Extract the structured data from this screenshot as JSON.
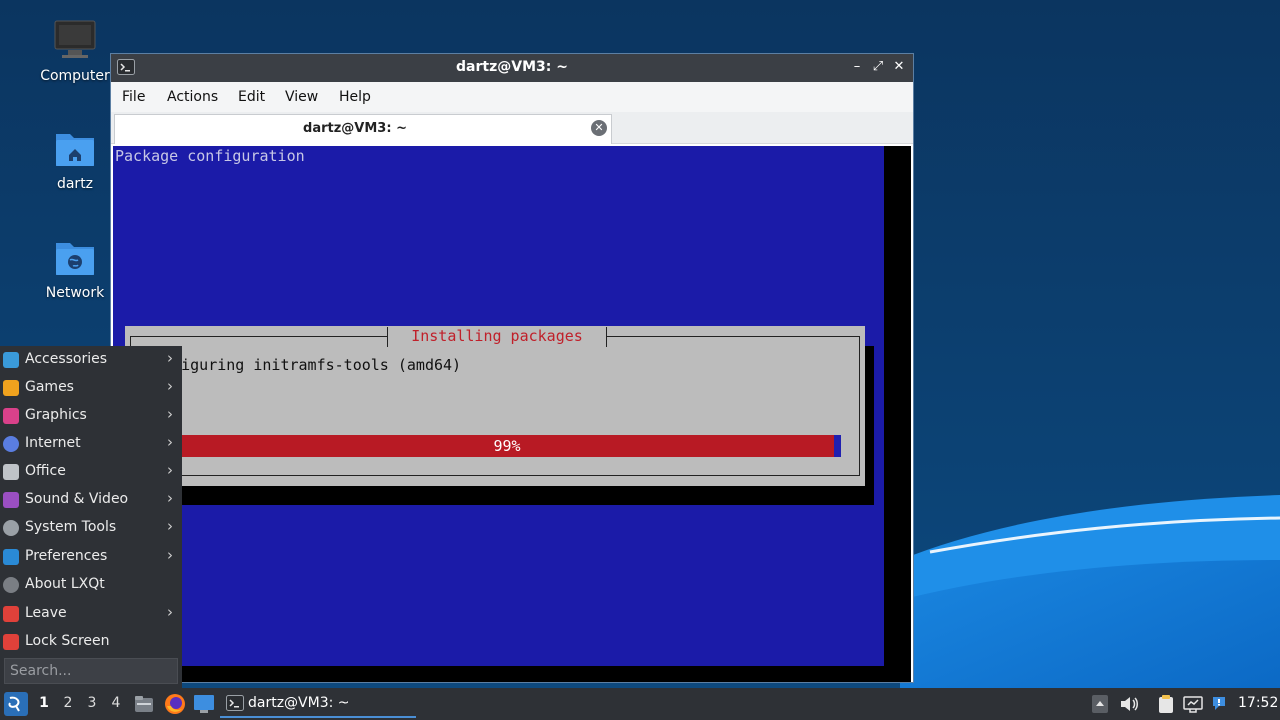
{
  "colors": {
    "accent": "#4a8fd6",
    "terminal_blue": "#1b1ba8",
    "progress_red": "#b81a24",
    "dialog_gray": "#bcbcbc",
    "panel_dark": "#2e3136"
  },
  "desktop": {
    "icons": [
      {
        "label": "Computer",
        "icon": "computer-icon"
      },
      {
        "label": "dartz",
        "icon": "home-folder-icon"
      },
      {
        "label": "Network",
        "icon": "network-folder-icon"
      }
    ]
  },
  "window": {
    "title": "dartz@VM3: ~",
    "menu": [
      "File",
      "Actions",
      "Edit",
      "View",
      "Help"
    ],
    "tab_label": "dartz@VM3: ~",
    "controls": {
      "minimize": "–",
      "maximize": "⤢",
      "close": "✕"
    }
  },
  "terminal": {
    "heading": "Package configuration",
    "dialog_title": "Installing packages",
    "message": "Configuring initramfs-tools (amd64)",
    "progress_label": "99%",
    "progress_fraction": 0.99
  },
  "start_menu": {
    "items": [
      {
        "label": "Accessories",
        "submenu": true,
        "icon": "accessories-icon",
        "color": "#3a9ad9"
      },
      {
        "label": "Games",
        "submenu": true,
        "icon": "games-icon",
        "color": "#f0a21e"
      },
      {
        "label": "Graphics",
        "submenu": true,
        "icon": "graphics-icon",
        "color": "#d9418a"
      },
      {
        "label": "Internet",
        "submenu": true,
        "icon": "internet-icon",
        "color": "#5a7de0"
      },
      {
        "label": "Office",
        "submenu": true,
        "icon": "office-icon",
        "color": "#bfc3c8"
      },
      {
        "label": "Sound & Video",
        "submenu": true,
        "icon": "sound-video-icon",
        "color": "#9b4fc2"
      },
      {
        "label": "System Tools",
        "submenu": true,
        "icon": "system-tools-icon",
        "color": "#9aa0a6"
      },
      {
        "label": "Preferences",
        "submenu": true,
        "icon": "preferences-icon",
        "color": "#2a8ad6"
      },
      {
        "label": "About LXQt",
        "submenu": false,
        "icon": "info-icon",
        "color": "#7a7e84"
      },
      {
        "label": "Leave",
        "submenu": true,
        "icon": "power-icon",
        "color": "#e0413a"
      },
      {
        "label": "Lock Screen",
        "submenu": false,
        "icon": "lock-icon",
        "color": "#e0413a"
      }
    ],
    "search_placeholder": "Search..."
  },
  "taskbar": {
    "workspaces": [
      "1",
      "2",
      "3",
      "4"
    ],
    "active_workspace": "1",
    "task_label": "dartz@VM3: ~",
    "clock": "17:52"
  }
}
